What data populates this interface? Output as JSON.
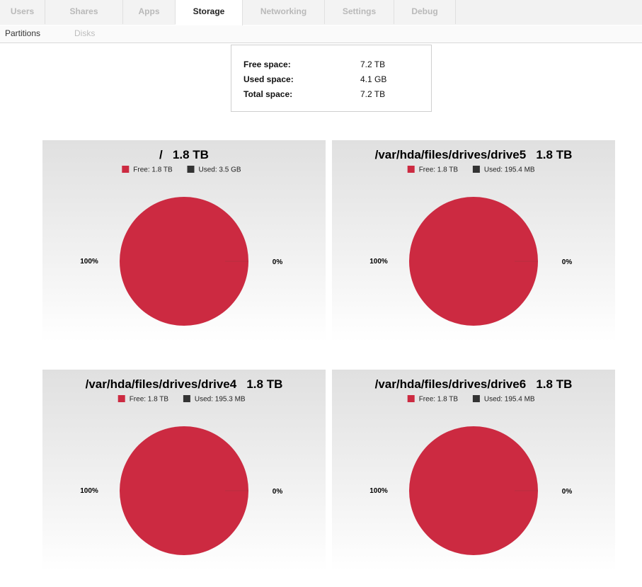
{
  "tabs": [
    {
      "label": "Users",
      "active": false
    },
    {
      "label": "Shares",
      "active": false
    },
    {
      "label": "Apps",
      "active": false
    },
    {
      "label": "Storage",
      "active": true
    },
    {
      "label": "Networking",
      "active": false
    },
    {
      "label": "Settings",
      "active": false
    },
    {
      "label": "Debug",
      "active": false
    }
  ],
  "subtabs": [
    {
      "label": "Partitions",
      "active": true
    },
    {
      "label": "Disks",
      "active": false
    }
  ],
  "summary": {
    "free_label": "Free space:",
    "free_value": "7.2 TB",
    "used_label": "Used space:",
    "used_value": "4.1 GB",
    "total_label": "Total space:",
    "total_value": "7.2 TB"
  },
  "colors": {
    "free": "#cc2a41",
    "used": "#333333"
  },
  "chart_data": [
    {
      "type": "pie",
      "title": "/   1.8 TB",
      "legend": [
        "Free: 1.8 TB",
        "Used: 3.5 GB"
      ],
      "labels": [
        "Free",
        "Used"
      ],
      "values": [
        100,
        0
      ],
      "slice_labels": [
        "100%",
        "0%"
      ]
    },
    {
      "type": "pie",
      "title": "/var/hda/files/drives/drive5   1.8 TB",
      "legend": [
        "Free: 1.8 TB",
        "Used: 195.4 MB"
      ],
      "labels": [
        "Free",
        "Used"
      ],
      "values": [
        100,
        0
      ],
      "slice_labels": [
        "100%",
        "0%"
      ]
    },
    {
      "type": "pie",
      "title": "/var/hda/files/drives/drive4   1.8 TB",
      "legend": [
        "Free: 1.8 TB",
        "Used: 195.3 MB"
      ],
      "labels": [
        "Free",
        "Used"
      ],
      "values": [
        100,
        0
      ],
      "slice_labels": [
        "100%",
        "0%"
      ]
    },
    {
      "type": "pie",
      "title": "/var/hda/files/drives/drive6   1.8 TB",
      "legend": [
        "Free: 1.8 TB",
        "Used: 195.4 MB"
      ],
      "labels": [
        "Free",
        "Used"
      ],
      "values": [
        100,
        0
      ],
      "slice_labels": [
        "100%",
        "0%"
      ]
    }
  ]
}
